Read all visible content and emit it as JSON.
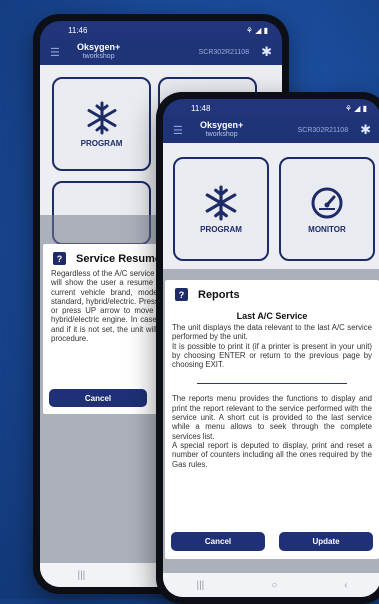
{
  "back_phone": {
    "status_time": "11:46",
    "status_icons": "⚘ ◢ ▮",
    "app_name": "Oksygen+",
    "app_sub": "tworkshop",
    "serial": "SCR302R21108",
    "tile_program": "PROGRAM",
    "dialog": {
      "title": "Service Resume",
      "body": "Regardless of the A/C service starting any procedure, the unit will show the user a resume screen. The screen shows the current vehicle brand, model and technology of vehicle: standard, hybrid/electric. Press ENTER to confirm the vehicle or press UP arrow to move to a 'not specified vehicle' or hybrid/electric engine. In case of a service on a new vehicle and if it is not set, the unit will prompt for an item to start the procedure.",
      "cancel": "Cancel"
    }
  },
  "front_phone": {
    "status_time": "11:48",
    "status_icons": "⚘ ◢ ▮",
    "app_name": "Oksygen+",
    "app_sub": "tworkshop",
    "serial": "SCR302R21108",
    "tile_program": "PROGRAM",
    "tile_monitor": "MONITOR",
    "dialog": {
      "title": "Reports",
      "subtitle": "Last A/C Service",
      "para1": "The unit displays the data relevant to the last A/C service performed by the unit.",
      "para2": "It is possible to print it (if a printer is present in your unit) by choosing ENTER or return to the previous page by choosing EXIT.",
      "para3": "The reports menu provides the functions to display and print the report relevant to the service performed with the service unit. A short cut is provided to the last service while a menu allows to seek through the complete services list.",
      "para4": "A special report is deputed to display, print and reset a number of counters including all the ones required by the Gas rules.",
      "cancel": "Cancel",
      "update": "Update"
    },
    "nav": {
      "recent": "|||",
      "home": "○",
      "back": "‹"
    }
  }
}
